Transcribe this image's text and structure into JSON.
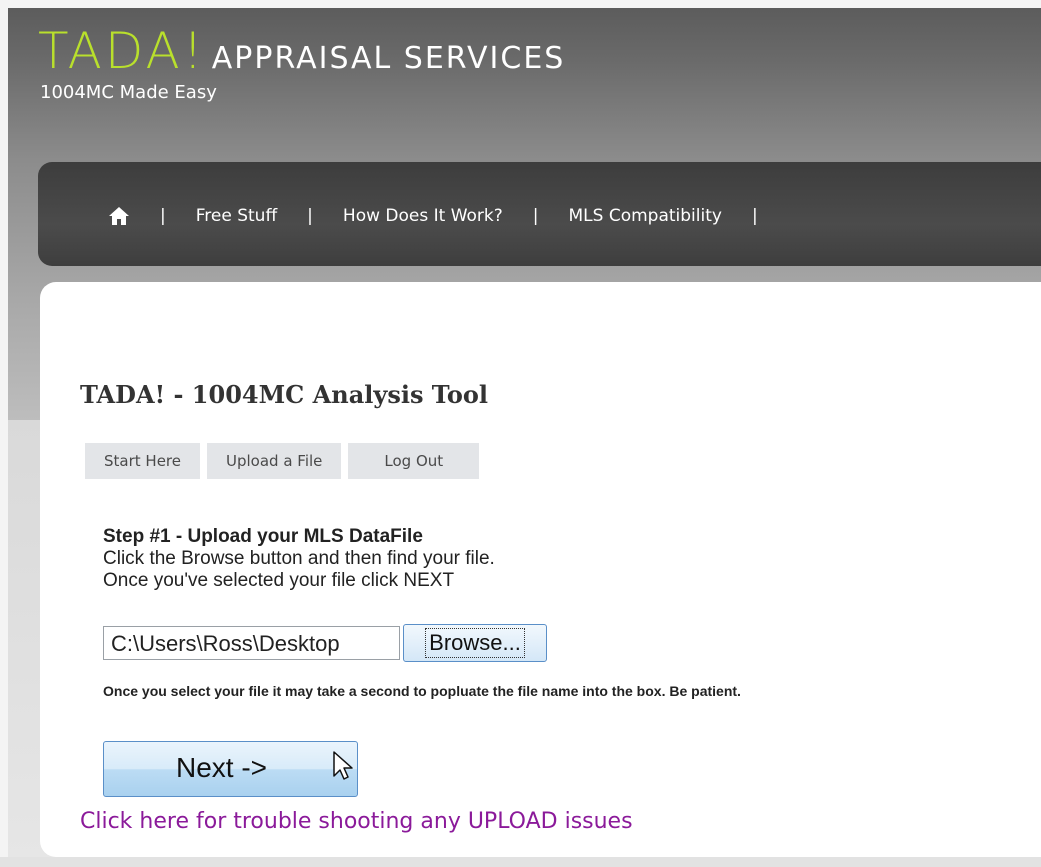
{
  "header": {
    "brand": "TADA!",
    "brand_rest": "APPRAISAL SERVICES",
    "tagline": "1004MC Made Easy"
  },
  "nav": {
    "home_icon": "home-icon",
    "separator": "|",
    "items": [
      "Free Stuff",
      "How Does It Work?",
      "MLS Compatibility"
    ]
  },
  "main": {
    "title": "TADA! - 1004MC Analysis Tool",
    "tabs": [
      "Start Here",
      "Upload a File",
      "Log Out"
    ],
    "step_title": "Step #1 - Upload your MLS DataFile",
    "step_line1": "Click the Browse button and then find your file.",
    "step_line2": "Once you've selected your file click NEXT",
    "file_value": "C:\\Users\\Ross\\Desktop",
    "browse_label": "Browse...",
    "note": "Once you select your file it may take a second to popluate the file name into the box. Be patient.",
    "next_label": "Next ->",
    "trouble_link": "Click here for trouble shooting any UPLOAD issues"
  },
  "colors": {
    "brand": "#b9e02c",
    "nav_bg": "#444444",
    "link": "#8b1a9a"
  }
}
